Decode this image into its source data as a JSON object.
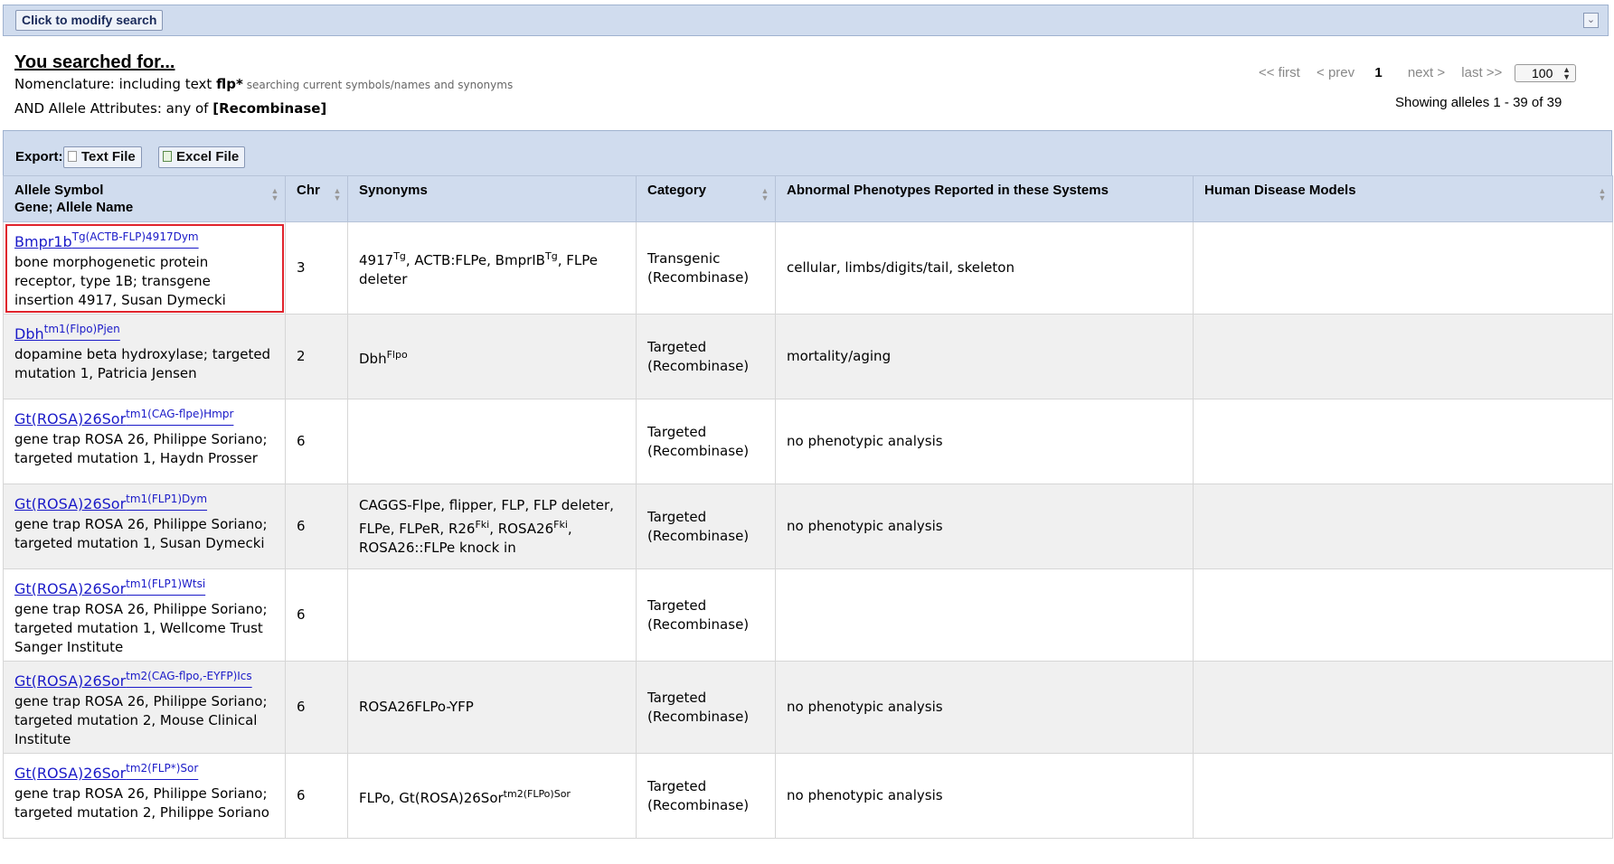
{
  "modify_search": {
    "label": "Click to modify search"
  },
  "summary": {
    "title": "You searched for...",
    "line1_prefix": "Nomenclature: including text ",
    "line1_term": "flp*",
    "line1_note": "searching current symbols/names and synonyms",
    "line2_prefix": "AND Allele Attributes: any of ",
    "line2_term": "[Recombinase]"
  },
  "pager": {
    "first": "<< first",
    "prev": "< prev",
    "current": "1",
    "next": "next >",
    "last": "last >>",
    "page_size": "100",
    "showing": "Showing alleles 1 - 39 of 39"
  },
  "export": {
    "label": "Export:",
    "text_file": "Text File",
    "excel_file": "Excel File"
  },
  "columns": {
    "allele_line1": "Allele Symbol",
    "allele_line2": "Gene; Allele Name",
    "chr": "Chr",
    "synonyms": "Synonyms",
    "category": "Category",
    "phenotypes": "Abnormal Phenotypes Reported in these Systems",
    "disease": "Human Disease Models"
  },
  "rows": [
    {
      "symbol": "Bmpr1b",
      "sup": "Tg(ACTB-FLP)4917Dym",
      "name": "bone morphogenetic protein receptor, type 1B; transgene insertion 4917, Susan Dymecki",
      "chr": "3",
      "synonyms": [
        {
          "t": "4917"
        },
        {
          "s": "Tg"
        },
        {
          "t": ", ACTB:FLPe, BmprIB"
        },
        {
          "s": "Tg"
        },
        {
          "t": ", FLPe deleter"
        }
      ],
      "category": "Transgenic (Recombinase)",
      "phenotypes": "cellular, limbs/digits/tail, skeleton",
      "disease": ""
    },
    {
      "symbol": "Dbh",
      "sup": "tm1(Flpo)Pjen",
      "name": "dopamine beta hydroxylase; targeted mutation 1, Patricia Jensen",
      "chr": "2",
      "synonyms": [
        {
          "t": "Dbh"
        },
        {
          "s": "Flpo"
        }
      ],
      "category": "Targeted (Recombinase)",
      "phenotypes": "mortality/aging",
      "disease": ""
    },
    {
      "symbol": "Gt(ROSA)26Sor",
      "sup": "tm1(CAG-flpe)Hmpr",
      "name": "gene trap ROSA 26, Philippe Soriano; targeted mutation 1, Haydn Prosser",
      "chr": "6",
      "synonyms": [],
      "category": "Targeted (Recombinase)",
      "phenotypes": "no phenotypic analysis",
      "disease": ""
    },
    {
      "symbol": "Gt(ROSA)26Sor",
      "sup": "tm1(FLP1)Dym",
      "name": "gene trap ROSA 26, Philippe Soriano; targeted mutation 1, Susan Dymecki",
      "chr": "6",
      "synonyms": [
        {
          "t": "CAGGS-Flpe, flipper, FLP, FLP deleter, FLPe, FLPeR, R26"
        },
        {
          "s": "Fki"
        },
        {
          "t": ", ROSA26"
        },
        {
          "s": "Fki"
        },
        {
          "t": ", ROSA26::FLPe knock in"
        }
      ],
      "category": "Targeted (Recombinase)",
      "phenotypes": "no phenotypic analysis",
      "disease": ""
    },
    {
      "symbol": "Gt(ROSA)26Sor",
      "sup": "tm1(FLP1)Wtsi",
      "name": "gene trap ROSA 26, Philippe Soriano; targeted mutation 1, Wellcome Trust Sanger Institute",
      "chr": "6",
      "synonyms": [],
      "category": "Targeted (Recombinase)",
      "phenotypes": "",
      "disease": ""
    },
    {
      "symbol": "Gt(ROSA)26Sor",
      "sup": "tm2(CAG-flpo,-EYFP)Ics",
      "name": "gene trap ROSA 26, Philippe Soriano; targeted mutation 2, Mouse Clinical Institute",
      "chr": "6",
      "synonyms": [
        {
          "t": "ROSA26FLPo-YFP"
        }
      ],
      "category": "Targeted (Recombinase)",
      "phenotypes": "no phenotypic analysis",
      "disease": ""
    },
    {
      "symbol": "Gt(ROSA)26Sor",
      "sup": "tm2(FLP*)Sor",
      "name": "gene trap ROSA 26, Philippe Soriano; targeted mutation 2, Philippe Soriano",
      "chr": "6",
      "synonyms": [
        {
          "t": "FLPo, Gt(ROSA)26Sor"
        },
        {
          "s": "tm2(FLPo)Sor"
        }
      ],
      "category": "Targeted (Recombinase)",
      "phenotypes": "no phenotypic analysis",
      "disease": ""
    }
  ]
}
